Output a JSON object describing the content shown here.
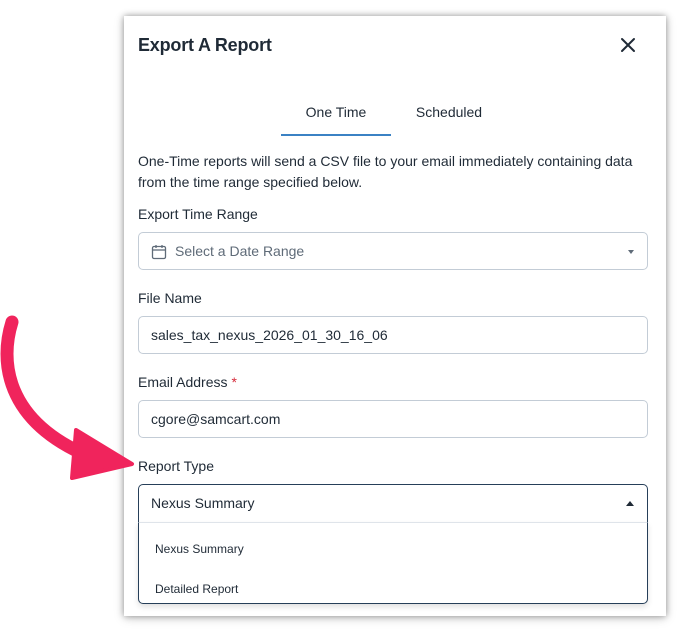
{
  "dialog": {
    "title": "Export A Report"
  },
  "tabs": [
    {
      "label": "One Time",
      "active": true
    },
    {
      "label": "Scheduled",
      "active": false
    }
  ],
  "description": "One-Time reports will send a CSV file to your email immediately containing data from the time range specified below.",
  "form": {
    "time_range": {
      "label": "Export Time Range",
      "placeholder": "Select a Date Range"
    },
    "file_name": {
      "label": "File Name",
      "value": "sales_tax_nexus_2026_01_30_16_06"
    },
    "email": {
      "label": "Email Address",
      "required_mark": "*",
      "value": "cgore@samcart.com"
    },
    "report_type": {
      "label": "Report Type",
      "value": "Nexus Summary",
      "options": [
        "Nexus Summary",
        "Detailed Report"
      ]
    }
  },
  "icons": {
    "close": "close-icon",
    "calendar": "calendar-icon",
    "dropdown": "chevron-down-icon",
    "dropup": "chevron-up-icon"
  },
  "colors": {
    "accent": "#3b82c4",
    "text": "#1f2a36",
    "required": "#d62a3a",
    "annotation_arrow": "#f0245c",
    "open_select_border": "#263f59"
  }
}
